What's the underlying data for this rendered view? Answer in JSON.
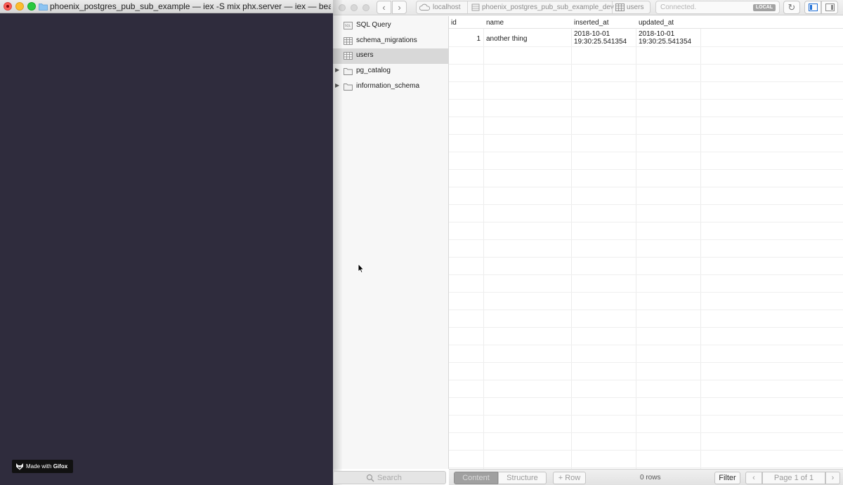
{
  "terminal": {
    "title": "phoenix_postgres_pub_sub_example — iex -S mix phx.server — iex — beam.s...",
    "watermark_prefix": "Made with",
    "watermark_brand": "Gifox",
    "background_color": "#2f2c3d"
  },
  "toolbar": {
    "back_icon": "‹",
    "forward_icon": "›",
    "breadcrumb_host": "localhost",
    "breadcrumb_database": "phoenix_postgres_pub_sub_example_dev",
    "breadcrumb_table": "users",
    "status_text": "Connected.",
    "local_badge": "LOCAL",
    "refresh_icon": "↻"
  },
  "sidebar": {
    "items": [
      {
        "label": "SQL Query",
        "icon": "sql-query-icon"
      },
      {
        "label": "schema_migrations",
        "icon": "table-icon"
      },
      {
        "label": "users",
        "icon": "table-icon",
        "selected": true
      },
      {
        "label": "pg_catalog",
        "icon": "folder-icon",
        "expandable": true
      },
      {
        "label": "information_schema",
        "icon": "folder-icon",
        "expandable": true
      }
    ],
    "search_placeholder": "Search",
    "disclosure_icon": "▶"
  },
  "table": {
    "columns": [
      "id",
      "name",
      "inserted_at",
      "updated_at"
    ],
    "rows": [
      {
        "id": "1",
        "name": "another thing",
        "inserted_at_date": "2018-10-01",
        "inserted_at_time": "19:30:25.541354",
        "updated_at_date": "2018-10-01",
        "updated_at_time": "19:30:25.541354"
      }
    ]
  },
  "bottom_bar": {
    "tab_content": "Content",
    "tab_structure": "Structure",
    "add_row": "+ Row",
    "rows_count": "0 rows",
    "filter": "Filter",
    "page_prev": "‹",
    "page_label": "Page 1 of 1",
    "page_next": "›"
  }
}
